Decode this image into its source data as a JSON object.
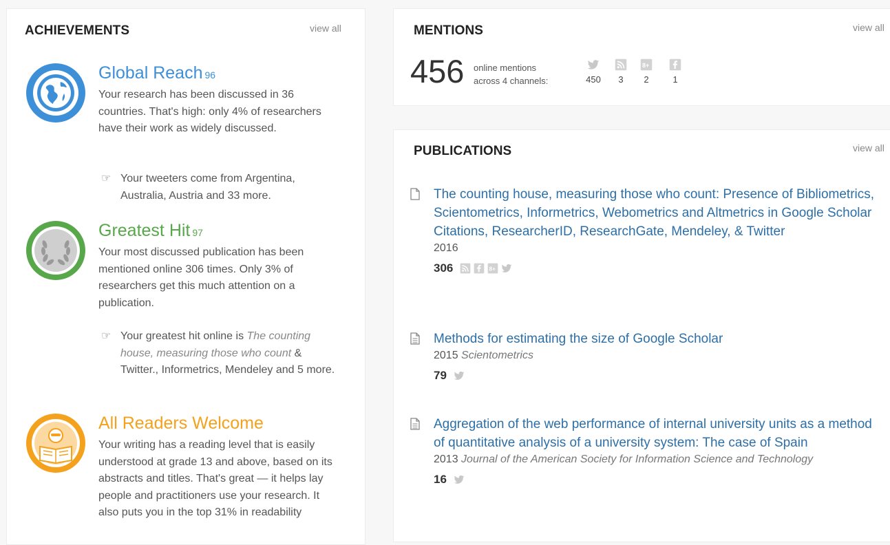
{
  "colors": {
    "blue": "#3d8fd8",
    "green": "#58a84b",
    "orange": "#f4a21d",
    "link": "#2d6fa6",
    "icon_grey": "#c8c8c8"
  },
  "achievements": {
    "title": "ACHIEVEMENTS",
    "view_all": "view all",
    "items": [
      {
        "name": "Global Reach",
        "score": "96",
        "icon": "globe-icon",
        "desc": "Your research has been discussed in 36 countries. That's high: only 4% of researchers have their work as widely discussed.",
        "note": "Your tweeters come from Argentina, Australia, Austria and 33 more."
      },
      {
        "name": "Greatest Hit",
        "score": "97",
        "icon": "laurel-wreath-icon",
        "desc": "Your most discussed publication has been mentioned online 306 times. Only 3% of researchers get this much attention on a publication.",
        "note_pre": "Your greatest hit online is ",
        "note_italic": "The counting house, measuring those who count",
        "note_post": " & Twitter., Informetrics, Mendeley and 5 more."
      },
      {
        "name": "All Readers Welcome",
        "score": "",
        "icon": "reader-icon",
        "desc": "Your writing has a reading level that is easily understood at grade 13 and above, based on its abstracts and titles. That's great — it helps lay people and practitioners use your research. It also puts you in the top 31% in readability"
      }
    ]
  },
  "mentions": {
    "title": "MENTIONS",
    "view_all": "view all",
    "total": "456",
    "label_line1": "online mentions",
    "label_line2": "across 4 channels:",
    "channels": [
      {
        "icon": "twitter-icon",
        "count": "450"
      },
      {
        "icon": "blog-rss-icon",
        "count": "3"
      },
      {
        "icon": "google-plus-icon",
        "count": "2"
      },
      {
        "icon": "facebook-icon",
        "count": "1"
      }
    ]
  },
  "publications": {
    "title": "PUBLICATIONS",
    "view_all": "view all",
    "items": [
      {
        "title": "The counting house, measuring those who count: Presence of Bibliometrics, Scientometrics, Informetrics, Webometrics and Altmetrics in Google Scholar Citations, ResearcherID, ResearchGate, Mendeley, & Twitter",
        "year": "2016",
        "journal": "",
        "count": "306",
        "channels": [
          "blog-rss-icon",
          "facebook-icon",
          "google-plus-icon",
          "twitter-icon"
        ]
      },
      {
        "title": "Methods for estimating the size of Google Scholar",
        "year": "2015",
        "journal": "Scientometrics",
        "count": "79",
        "channels": [
          "twitter-icon"
        ]
      },
      {
        "title": "Aggregation of the web performance of internal university units as a method of quantitative analysis of a university system: The case of Spain",
        "year": "2013",
        "journal": "Journal of the American Society for Information Science and Technology",
        "count": "16",
        "channels": [
          "twitter-icon"
        ]
      }
    ]
  }
}
